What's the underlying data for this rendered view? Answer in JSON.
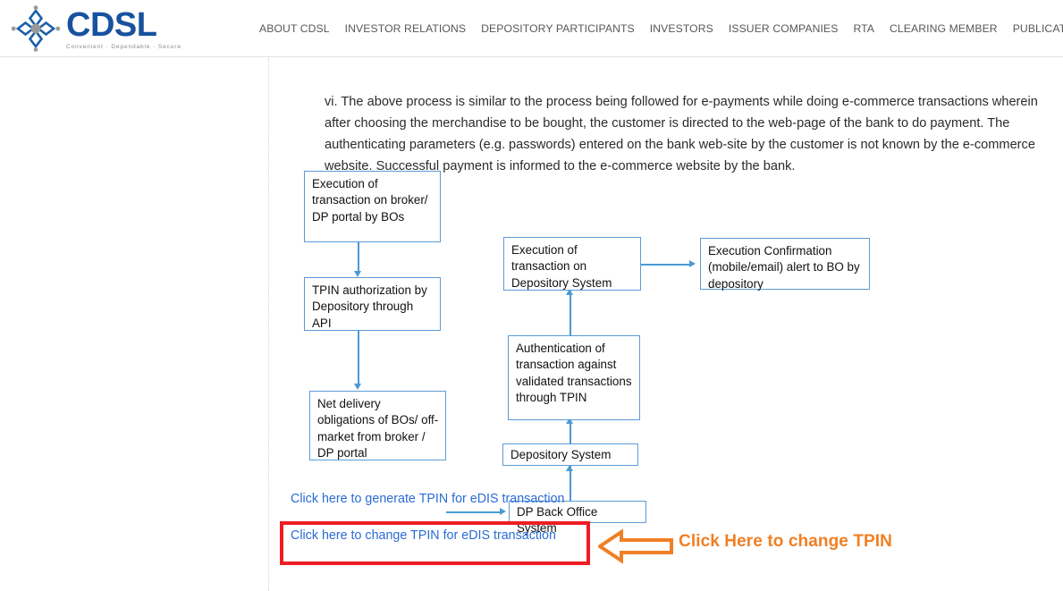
{
  "header": {
    "logo": {
      "icon": "cdsl-diamond-logo",
      "text": "CDSL",
      "tagline": "Convenient  ·  Dependable  ·  Secure",
      "brand_color": "#18529e"
    },
    "nav": [
      {
        "label": "ABOUT CDSL"
      },
      {
        "label": "INVESTOR RELATIONS"
      },
      {
        "label": "DEPOSITORY PARTICIPANTS"
      },
      {
        "label": "INVESTORS"
      },
      {
        "label": "ISSUER COMPANIES"
      },
      {
        "label": "RTA"
      },
      {
        "label": "CLEARING MEMBER"
      },
      {
        "label": "PUBLICATIONS"
      }
    ]
  },
  "content": {
    "intro_paragraph": "vi. The above process is similar to the process being followed for e-payments while doing e-commerce transactions wherein after choosing the merchandise to be bought, the customer is directed to the web-page of the bank to do payment. The authenticating parameters (e.g. passwords) entered on the bank web-site by the customer is not known by the e-commerce website. Successful payment is informed to the e-commerce website by the bank.",
    "flowchart": {
      "border_color": "#5b9bd5",
      "connector_color": "#4a9ad4",
      "boxes": [
        {
          "id": "execution-broker-portal",
          "text": "Execution of transaction on broker/ DP portal by BOs"
        },
        {
          "id": "tpin-authorization",
          "text": "TPIN authorization by Depository through API"
        },
        {
          "id": "net-delivery-obligations",
          "text": "Net delivery obligations of BOs/ off-market  from broker / DP portal"
        },
        {
          "id": "dp-back-office-system",
          "text": "DP Back Office System"
        },
        {
          "id": "depository-system",
          "text": "Depository System"
        },
        {
          "id": "authentication-of-transaction",
          "text": "Authentication of transaction against validated transactions through TPIN"
        },
        {
          "id": "execution-depository-system",
          "text": "Execution of transaction on Depository System"
        },
        {
          "id": "execution-confirmation",
          "text": "Execution Confirmation (mobile/email) alert to BO by depository"
        }
      ]
    },
    "links": {
      "generate_tpin": "Click here to generate TPIN for eDIS transaction",
      "change_tpin": "Click here to change TPIN for eDIS transaction",
      "link_color": "#2b6cd4"
    },
    "callout": {
      "text": "Click Here to change TPIN",
      "color": "#f07f24",
      "highlight_color": "#ee1d23",
      "arrow_icon": "left-block-arrow-icon"
    }
  }
}
